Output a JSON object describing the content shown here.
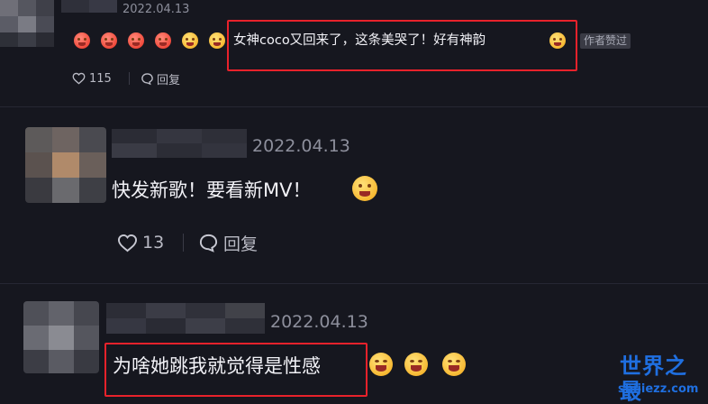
{
  "comments": [
    {
      "date": "2022.04.13",
      "text": "女神coco又回来了，这条美哭了！好有神韵",
      "badge": "作者赞过",
      "likes": "115",
      "reply_label": "回复"
    },
    {
      "date": "2022.04.13",
      "text": "快发新歌！要看新MV！",
      "likes": "13",
      "reply_label": "回复"
    },
    {
      "date": "2022.04.13",
      "text": "为啥她跳我就觉得是性感"
    }
  ],
  "watermark": {
    "title": "世界之最",
    "site": "shijiezz.com"
  },
  "colors": {
    "background": "#16171f",
    "highlight_box": "#e8222b",
    "watermark": "#1f6fe0"
  }
}
